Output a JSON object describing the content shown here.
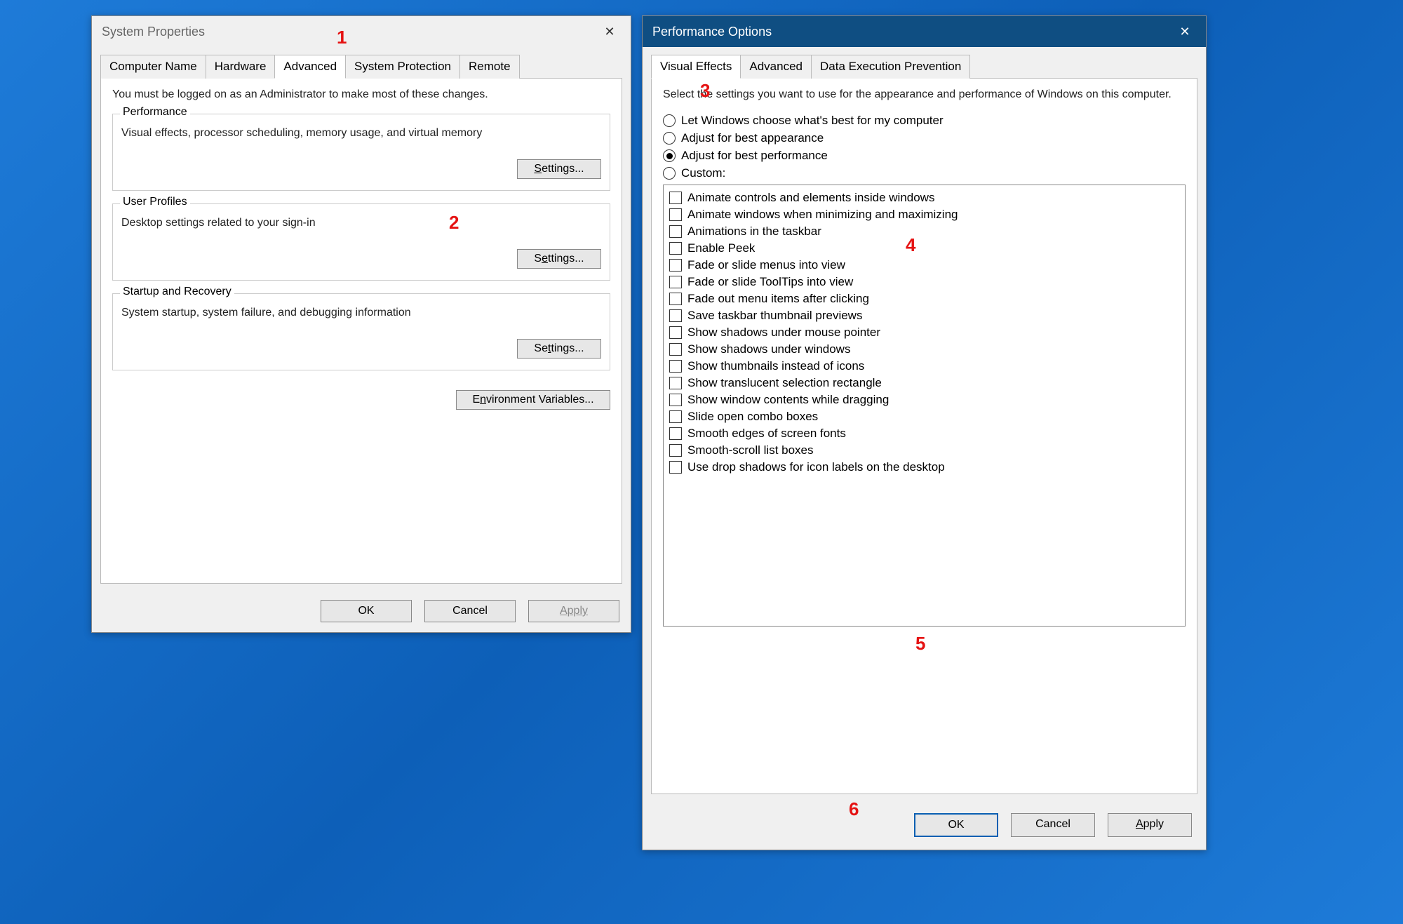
{
  "sysprops": {
    "title": "System Properties",
    "tabs": [
      "Computer Name",
      "Hardware",
      "Advanced",
      "System Protection",
      "Remote"
    ],
    "active_tab": "Advanced",
    "intro": "You must be logged on as an Administrator to make most of these changes.",
    "groups": {
      "performance": {
        "legend": "Performance",
        "text": "Visual effects, processor scheduling, memory usage, and virtual memory",
        "button": "Settings..."
      },
      "user_profiles": {
        "legend": "User Profiles",
        "text": "Desktop settings related to your sign-in",
        "button": "Settings..."
      },
      "startup": {
        "legend": "Startup and Recovery",
        "text": "System startup, system failure, and debugging information",
        "button": "Settings..."
      }
    },
    "env_button": "Environment Variables...",
    "ok": "OK",
    "cancel": "Cancel",
    "apply": "Apply"
  },
  "perf": {
    "title": "Performance Options",
    "tabs": [
      "Visual Effects",
      "Advanced",
      "Data Execution Prevention"
    ],
    "active_tab": "Visual Effects",
    "intro": "Select the settings you want to use for the appearance and performance of Windows on this computer.",
    "radios": [
      "Let Windows choose what's best for my computer",
      "Adjust for best appearance",
      "Adjust for best performance",
      "Custom:"
    ],
    "selected_radio": 2,
    "checks": [
      "Animate controls and elements inside windows",
      "Animate windows when minimizing and maximizing",
      "Animations in the taskbar",
      "Enable Peek",
      "Fade or slide menus into view",
      "Fade or slide ToolTips into view",
      "Fade out menu items after clicking",
      "Save taskbar thumbnail previews",
      "Show shadows under mouse pointer",
      "Show shadows under windows",
      "Show thumbnails instead of icons",
      "Show translucent selection rectangle",
      "Show window contents while dragging",
      "Slide open combo boxes",
      "Smooth edges of screen fonts",
      "Smooth-scroll list boxes",
      "Use drop shadows for icon labels on the desktop"
    ],
    "ok": "OK",
    "cancel": "Cancel",
    "apply": "Apply"
  },
  "annotations": {
    "1": "1",
    "2": "2",
    "3": "3",
    "4": "4",
    "5": "5",
    "6": "6"
  }
}
